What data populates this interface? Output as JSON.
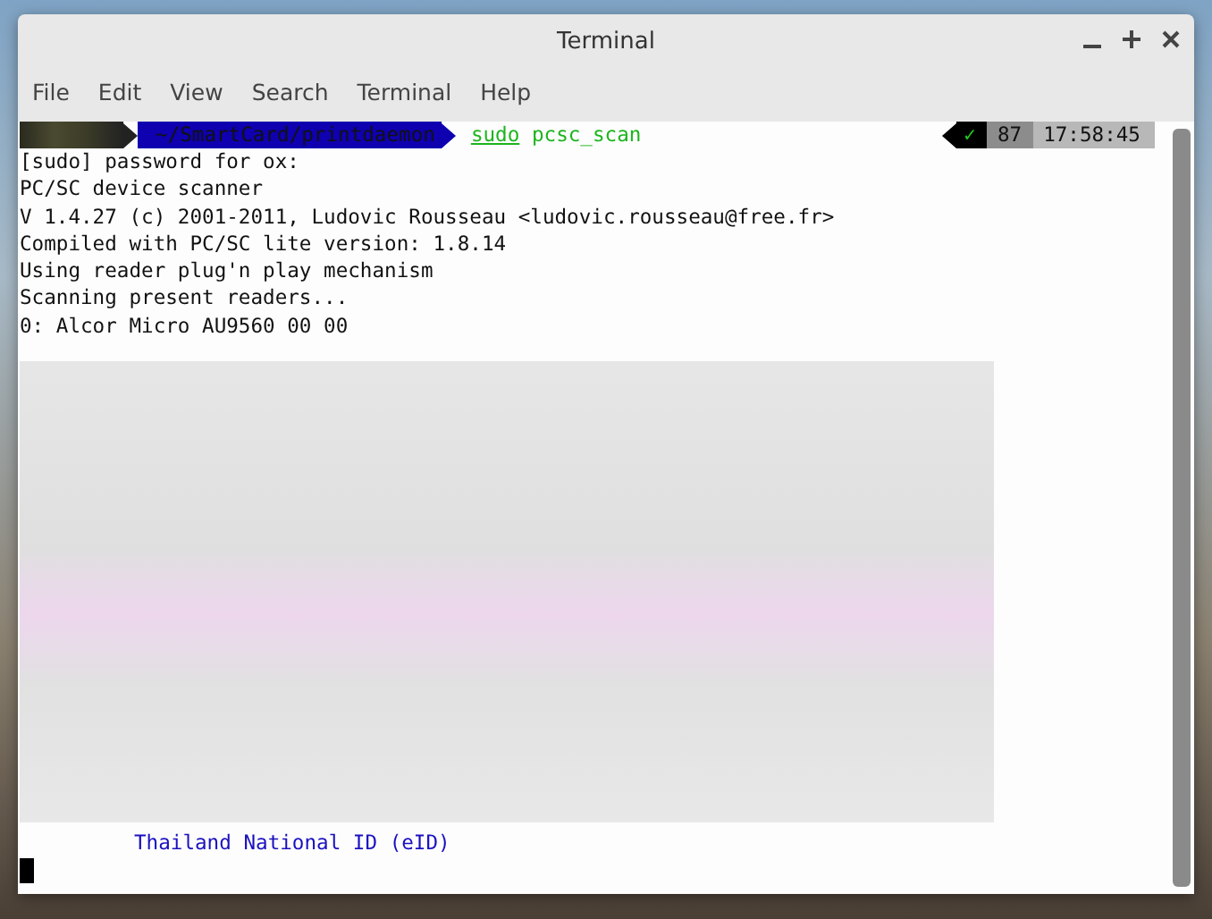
{
  "window": {
    "title": "Terminal"
  },
  "menu": [
    "File",
    "Edit",
    "View",
    "Search",
    "Terminal",
    "Help"
  ],
  "prompt": {
    "directory": "~/SmartCard/printdaemon",
    "command": "sudo",
    "args": "pcsc_scan",
    "status": "✓",
    "history_number": "87",
    "time": "17:58:45"
  },
  "output": [
    "[sudo] password for ox:",
    "PC/SC device scanner",
    "V 1.4.27 (c) 2001-2011, Ludovic Rousseau <ludovic.rousseau@free.fr>",
    "Compiled with PC/SC lite version: 1.8.14",
    "Using reader plug'n play mechanism",
    "Scanning present readers...",
    "0: Alcor Micro AU9560 00 00"
  ],
  "card_name": "Thailand National ID (eID)"
}
